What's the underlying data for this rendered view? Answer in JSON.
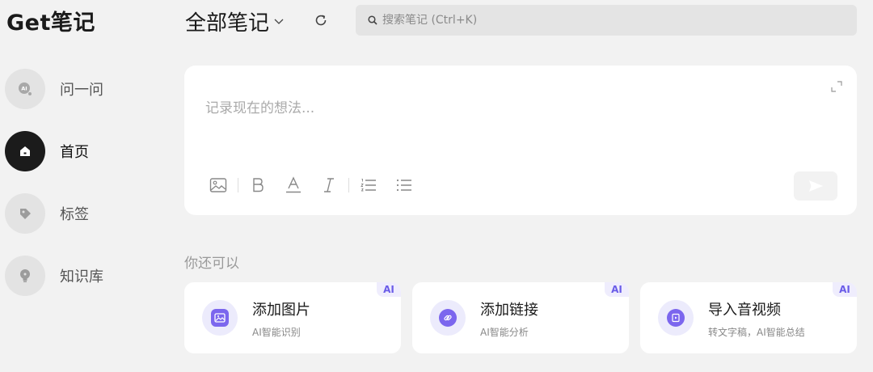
{
  "app": {
    "logo": "Get笔记"
  },
  "sidebar": {
    "items": [
      {
        "label": "问一问",
        "icon": "ai-chat-icon",
        "active": false
      },
      {
        "label": "首页",
        "icon": "home-icon",
        "active": true
      },
      {
        "label": "标签",
        "icon": "tag-icon",
        "active": false
      },
      {
        "label": "知识库",
        "icon": "lightbulb-icon",
        "active": false
      }
    ]
  },
  "header": {
    "title": "全部笔记",
    "search_placeholder": "搜索笔记 (Ctrl+K)",
    "search_value": ""
  },
  "editor": {
    "placeholder": "记录现在的想法...",
    "tools": [
      "image-icon",
      "bold-icon",
      "text-color-icon",
      "italic-icon",
      "ordered-list-icon",
      "bullet-list-icon"
    ]
  },
  "suggestions": {
    "title": "你还可以",
    "cards": [
      {
        "title": "添加图片",
        "subtitle": "AI智能识别",
        "badge": "AI",
        "icon": "picture-icon"
      },
      {
        "title": "添加链接",
        "subtitle": "AI智能分析",
        "badge": "AI",
        "icon": "link-icon"
      },
      {
        "title": "导入音视频",
        "subtitle": "转文字稿，AI智能总结",
        "badge": "AI",
        "icon": "media-icon"
      }
    ]
  },
  "colors": {
    "accent": "#7b66ee",
    "badge_bg": "#efedfd",
    "active_nav": "#1b1b1b"
  }
}
